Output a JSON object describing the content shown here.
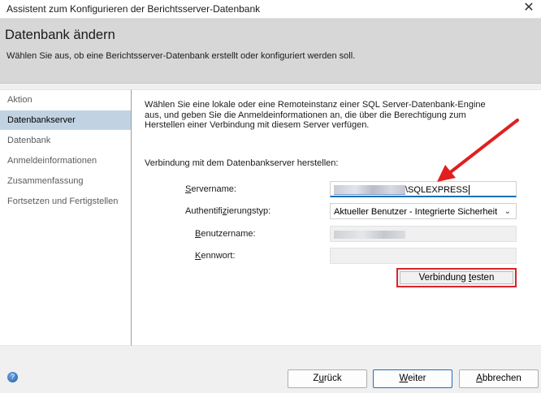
{
  "window": {
    "title": "Assistent zum Konfigurieren der Berichtsserver-Datenbank",
    "close_symbol": "✕"
  },
  "header": {
    "title": "Datenbank ändern",
    "subtitle": "Wählen Sie aus, ob eine Berichtsserver-Datenbank erstellt oder konfiguriert werden soll."
  },
  "sidebar": {
    "items": [
      {
        "label": "Aktion",
        "active": false
      },
      {
        "label": "Datenbankserver",
        "active": true
      },
      {
        "label": "Datenbank",
        "active": false
      },
      {
        "label": "Anmeldeinformationen",
        "active": false
      },
      {
        "label": "Zusammenfassung",
        "active": false
      },
      {
        "label": "Fortsetzen und Fertigstellen",
        "active": false
      }
    ]
  },
  "main": {
    "intro": "Wählen Sie eine lokale oder eine Remoteinstanz einer SQL Server-Datenbank-Engine aus, und geben Sie die Anmeldeinformationen an, die über die Berechtigung zum Herstellen einer Verbindung mit diesem Server verfügen.",
    "connect_label": "Verbindung mit dem Datenbankserver herstellen:",
    "server_label": {
      "key": "S",
      "rest": "ervername:"
    },
    "server_value_suffix": "\\SQLEXPRESS",
    "auth_label": {
      "pre": "Authentifi",
      "key": "z",
      "rest": "ierungstyp:"
    },
    "auth_value": "Aktueller Benutzer - Integrierte Sicherheit",
    "user_label": {
      "key": "B",
      "rest": "enutzername:"
    },
    "password_label": {
      "key": "K",
      "rest": "ennwort:"
    },
    "test_button": {
      "pre": "Verbindung ",
      "key": "t",
      "rest": "esten"
    }
  },
  "footer": {
    "back": {
      "pre": "Z",
      "key": "u",
      "rest": "rück"
    },
    "next": {
      "pre": "",
      "key": "W",
      "rest": "eiter"
    },
    "cancel": {
      "pre": "",
      "key": "A",
      "rest": "bbrechen"
    }
  },
  "colors": {
    "highlight_red": "#d9252b",
    "active_sidebar": "#c1d3e3",
    "focus_blue": "#1a6fb5"
  },
  "icons": [
    "close-icon",
    "chevron-down-icon",
    "help-icon",
    "red-arrow"
  ]
}
